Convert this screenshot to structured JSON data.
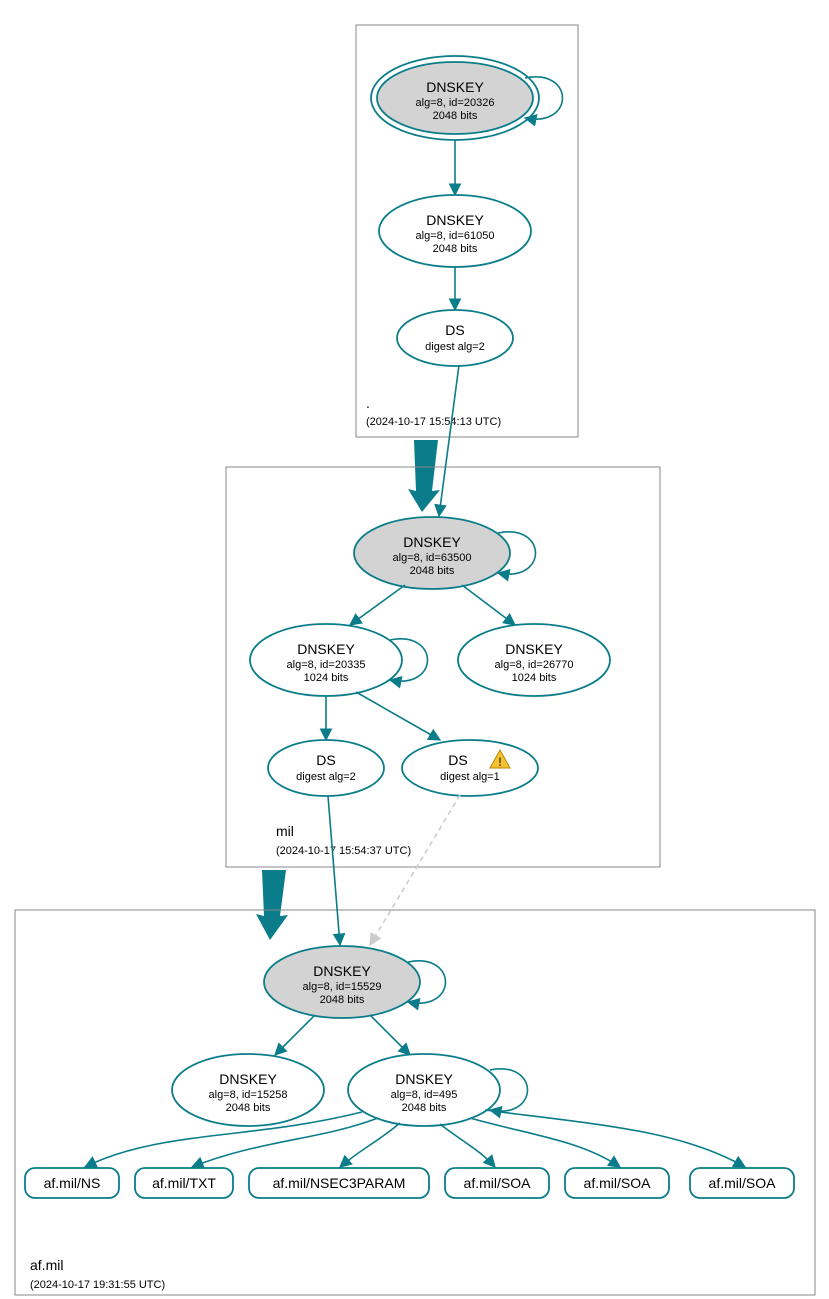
{
  "colors": {
    "line": "#0B7D8A",
    "ksk_fill": "#d3d3d3",
    "dashed": "#cccccc"
  },
  "zones": {
    "root": {
      "label": ".",
      "timestamp": "(2024-10-17 15:54:13 UTC)"
    },
    "mil": {
      "label": "mil",
      "timestamp": "(2024-10-17 15:54:37 UTC)"
    },
    "afmil": {
      "label": "af.mil",
      "timestamp": "(2024-10-17 19:31:55 UTC)"
    }
  },
  "nodes": {
    "root_ksk": {
      "title": "DNSKEY",
      "l2": "alg=8, id=20326",
      "l3": "2048 bits"
    },
    "root_zsk": {
      "title": "DNSKEY",
      "l2": "alg=8, id=61050",
      "l3": "2048 bits"
    },
    "root_ds": {
      "title": "DS",
      "l2": "digest alg=2"
    },
    "mil_ksk": {
      "title": "DNSKEY",
      "l2": "alg=8, id=63500",
      "l3": "2048 bits"
    },
    "mil_zsk1": {
      "title": "DNSKEY",
      "l2": "alg=8, id=20335",
      "l3": "1024 bits"
    },
    "mil_zsk2": {
      "title": "DNSKEY",
      "l2": "alg=8, id=26770",
      "l3": "1024 bits"
    },
    "mil_ds1": {
      "title": "DS",
      "l2": "digest alg=2"
    },
    "mil_ds2": {
      "title": "DS",
      "l2": "digest alg=1"
    },
    "af_ksk": {
      "title": "DNSKEY",
      "l2": "alg=8, id=15529",
      "l3": "2048 bits"
    },
    "af_zsk1": {
      "title": "DNSKEY",
      "l2": "alg=8, id=15258",
      "l3": "2048 bits"
    },
    "af_zsk2": {
      "title": "DNSKEY",
      "l2": "alg=8, id=495",
      "l3": "2048 bits"
    }
  },
  "rrsets": {
    "r1": "af.mil/NS",
    "r2": "af.mil/TXT",
    "r3": "af.mil/NSEC3PARAM",
    "r4": "af.mil/SOA",
    "r5": "af.mil/SOA",
    "r6": "af.mil/SOA"
  },
  "chart_data": {
    "type": "tree",
    "description": "DNSSEC authentication chain / DNSViz-style graph",
    "zones": [
      {
        "name": ".",
        "timestamp": "2024-10-17 15:54:13 UTC",
        "nodes": [
          {
            "id": "root_ksk",
            "type": "DNSKEY",
            "alg": 8,
            "key_id": 20326,
            "bits": 2048,
            "ksk": true,
            "trust_anchor": true
          },
          {
            "id": "root_zsk",
            "type": "DNSKEY",
            "alg": 8,
            "key_id": 61050,
            "bits": 2048
          },
          {
            "id": "root_ds",
            "type": "DS",
            "digest_alg": 2
          }
        ],
        "edges": [
          {
            "from": "root_ksk",
            "to": "root_ksk",
            "self": true
          },
          {
            "from": "root_ksk",
            "to": "root_zsk"
          },
          {
            "from": "root_zsk",
            "to": "root_ds"
          }
        ]
      },
      {
        "name": "mil",
        "timestamp": "2024-10-17 15:54:37 UTC",
        "parent_ds": "root_ds",
        "nodes": [
          {
            "id": "mil_ksk",
            "type": "DNSKEY",
            "alg": 8,
            "key_id": 63500,
            "bits": 2048,
            "ksk": true
          },
          {
            "id": "mil_zsk1",
            "type": "DNSKEY",
            "alg": 8,
            "key_id": 20335,
            "bits": 1024
          },
          {
            "id": "mil_zsk2",
            "type": "DNSKEY",
            "alg": 8,
            "key_id": 26770,
            "bits": 1024
          },
          {
            "id": "mil_ds1",
            "type": "DS",
            "digest_alg": 2
          },
          {
            "id": "mil_ds2",
            "type": "DS",
            "digest_alg": 1,
            "warning": true
          }
        ],
        "edges": [
          {
            "from": "root_ds",
            "to": "mil_ksk"
          },
          {
            "from": "mil_ksk",
            "to": "mil_ksk",
            "self": true
          },
          {
            "from": "mil_ksk",
            "to": "mil_zsk1"
          },
          {
            "from": "mil_ksk",
            "to": "mil_zsk2"
          },
          {
            "from": "mil_zsk1",
            "to": "mil_zsk1",
            "self": true
          },
          {
            "from": "mil_zsk1",
            "to": "mil_ds1"
          },
          {
            "from": "mil_zsk1",
            "to": "mil_ds2"
          }
        ]
      },
      {
        "name": "af.mil",
        "timestamp": "2024-10-17 19:31:55 UTC",
        "nodes": [
          {
            "id": "af_ksk",
            "type": "DNSKEY",
            "alg": 8,
            "key_id": 15529,
            "bits": 2048,
            "ksk": true
          },
          {
            "id": "af_zsk1",
            "type": "DNSKEY",
            "alg": 8,
            "key_id": 15258,
            "bits": 2048
          },
          {
            "id": "af_zsk2",
            "type": "DNSKEY",
            "alg": 8,
            "key_id": 495,
            "bits": 2048
          }
        ],
        "rrsets": [
          "af.mil/NS",
          "af.mil/TXT",
          "af.mil/NSEC3PARAM",
          "af.mil/SOA",
          "af.mil/SOA",
          "af.mil/SOA"
        ],
        "edges": [
          {
            "from": "mil_ds1",
            "to": "af_ksk"
          },
          {
            "from": "mil_ds2",
            "to": "af_ksk",
            "style": "dashed"
          },
          {
            "from": "af_ksk",
            "to": "af_ksk",
            "self": true
          },
          {
            "from": "af_ksk",
            "to": "af_zsk1"
          },
          {
            "from": "af_ksk",
            "to": "af_zsk2"
          },
          {
            "from": "af_zsk2",
            "to": "af_zsk2",
            "self": true
          },
          {
            "from": "af_zsk2",
            "to": "af.mil/NS"
          },
          {
            "from": "af_zsk2",
            "to": "af.mil/TXT"
          },
          {
            "from": "af_zsk2",
            "to": "af.mil/NSEC3PARAM"
          },
          {
            "from": "af_zsk2",
            "to": "af.mil/SOA"
          },
          {
            "from": "af_zsk2",
            "to": "af.mil/SOA"
          },
          {
            "from": "af_zsk2",
            "to": "af.mil/SOA"
          }
        ]
      }
    ]
  }
}
